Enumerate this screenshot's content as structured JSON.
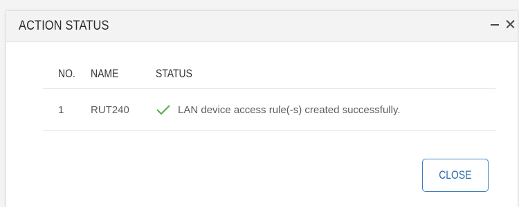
{
  "dialog": {
    "title": "ACTION STATUS"
  },
  "table": {
    "headers": {
      "no": "NO.",
      "name": "NAME",
      "status": "STATUS"
    },
    "rows": [
      {
        "no": "1",
        "name": "RUT240",
        "status_icon": "checkmark-icon",
        "status_text": "LAN device access rule(-s) created successfully."
      }
    ]
  },
  "buttons": {
    "close_label": "CLOSE"
  },
  "colors": {
    "accent": "#2b6ab0",
    "success": "#4cae4c",
    "header_bg": "#f3f3f3"
  }
}
